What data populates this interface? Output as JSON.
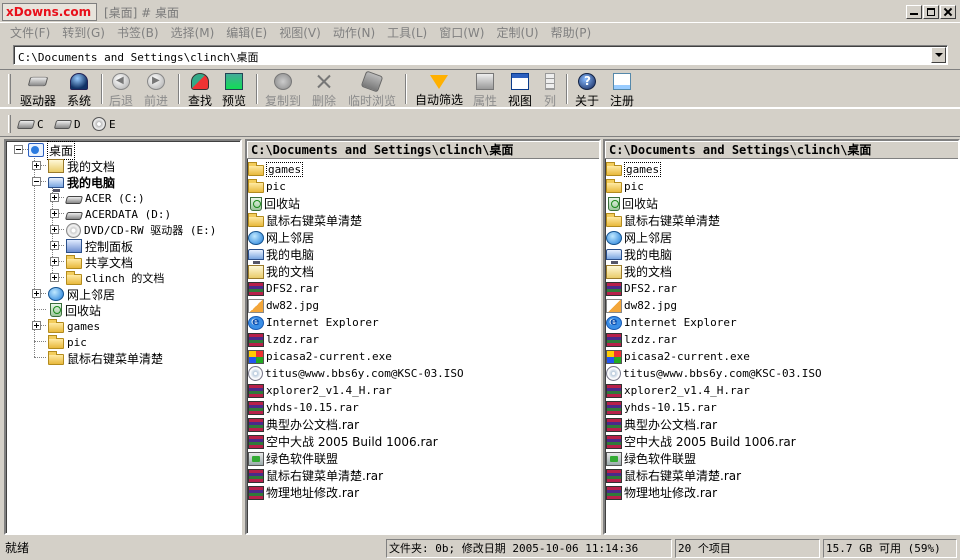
{
  "brand": {
    "text": "xDowns.com"
  },
  "window": {
    "title": "[桌面] # 桌面"
  },
  "menu": [
    "文件(F)",
    "转到(G)",
    "书签(B)",
    "选择(M)",
    "编辑(E)",
    "视图(V)",
    "动作(N)",
    "工具(L)",
    "窗口(W)",
    "定制(U)",
    "帮助(P)"
  ],
  "address": {
    "value": "C:\\Documents and Settings\\clinch\\桌面"
  },
  "toolbar": {
    "drives": "驱动器",
    "system": "系统",
    "back": "后退",
    "forward": "前进",
    "find": "查找",
    "preview": "预览",
    "copy": "复制到",
    "delete": "删除",
    "browse": "临时浏览",
    "filter": "自动筛选",
    "properties": "属性",
    "view": "视图",
    "columns": "列",
    "about": "关于",
    "register": "注册"
  },
  "drivebar": {
    "c": "C",
    "d": "D",
    "e": "E"
  },
  "tree": {
    "desktop": "桌面",
    "mydocs": "我的文档",
    "mypc": "我的电脑",
    "acer": "ACER (C:)",
    "acerdata": "ACERDATA (D:)",
    "dvd": "DVD/CD-RW 驱动器 (E:)",
    "cpanel": "控制面板",
    "shared": "共享文档",
    "clinch_docs": "clinch 的文档",
    "network": "网上邻居",
    "recycle": "回收站",
    "games": "games",
    "pic": "pic",
    "rightclick": "鼠标右键菜单清楚"
  },
  "pane_left": {
    "path": "C:\\Documents and Settings\\clinch\\桌面",
    "items": [
      "games",
      "pic",
      "回收站",
      "鼠标右键菜单清楚",
      "网上邻居",
      "我的电脑",
      "我的文档",
      "DFS2.rar",
      "dw82.jpg",
      "Internet Explorer",
      "lzdz.rar",
      "picasa2-current.exe",
      "titus@www.bbs6y.com@KSC-03.ISO",
      "xplorer2_v1.4_H.rar",
      "yhds-10.15.rar",
      "典型办公文档.rar",
      "空中大战 2005 Build 1006.rar",
      "绿色软件联盟",
      "鼠标右键菜单清楚.rar",
      "物理地址修改.rar"
    ]
  },
  "pane_right": {
    "path": "C:\\Documents and Settings\\clinch\\桌面",
    "items": [
      "games",
      "pic",
      "回收站",
      "鼠标右键菜单清楚",
      "网上邻居",
      "我的电脑",
      "我的文档",
      "DFS2.rar",
      "dw82.jpg",
      "Internet Explorer",
      "lzdz.rar",
      "picasa2-current.exe",
      "titus@www.bbs6y.com@KSC-03.ISO",
      "xplorer2_v1.4_H.rar",
      "yhds-10.15.rar",
      "典型办公文档.rar",
      "空中大战 2005 Build 1006.rar",
      "绿色软件联盟",
      "鼠标右键菜单清楚.rar",
      "物理地址修改.rar"
    ]
  },
  "status": {
    "ready": "就绪",
    "fileinfo": "文件夹: 0b; 修改日期 2005-10-06 11:14:36",
    "count": "20 个项目",
    "free": "15.7 GB 可用 (59%)"
  }
}
